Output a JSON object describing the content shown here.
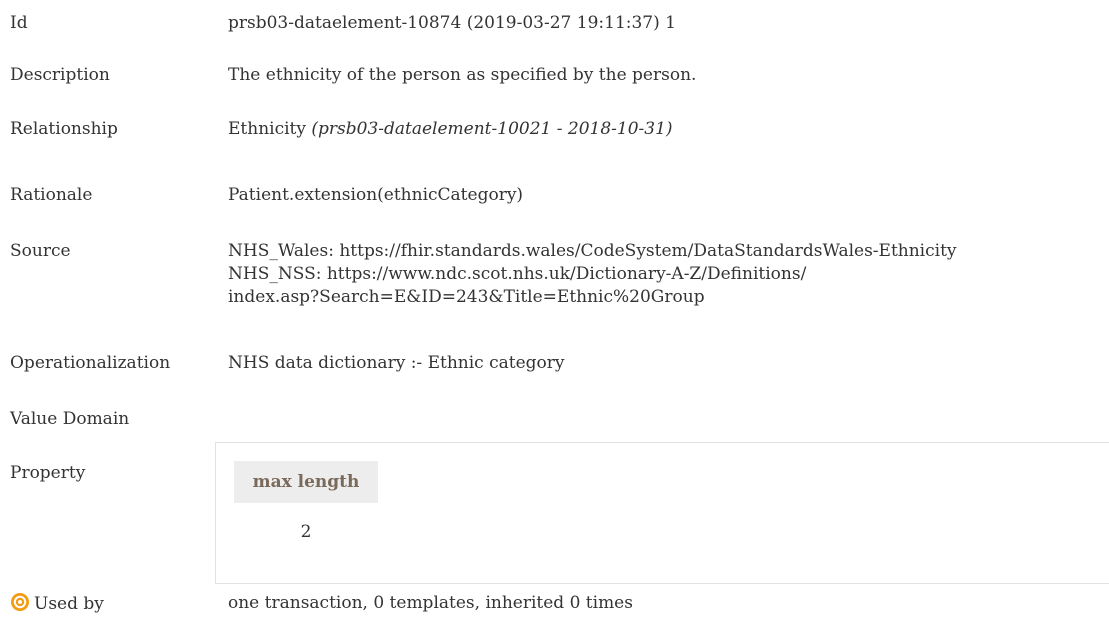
{
  "rows": {
    "id": {
      "label": "Id",
      "value": "prsb03-dataelement-10874 (2019-03-27 19:11:37) 1"
    },
    "description": {
      "label": "Description",
      "value": "The ethnicity of the person as specified by the person."
    },
    "relationship": {
      "label": "Relationship",
      "name": "Ethnicity",
      "ref": "(prsb03-dataelement-10021 - 2018-10-31)"
    },
    "rationale": {
      "label": "Rationale",
      "value": "Patient.extension(ethnicCategory)"
    },
    "source": {
      "label": "Source",
      "lines": [
        "NHS_Wales: https://fhir.standards.wales/CodeSystem/DataStandardsWales-Ethnicity",
        "NHS_NSS: https://www.ndc.scot.nhs.uk/Dictionary-A-Z/Definitions/",
        "index.asp?Search=E&ID=243&Title=Ethnic%20Group"
      ]
    },
    "operationalization": {
      "label": "Operationalization",
      "value": "NHS data dictionary :- Ethnic category"
    },
    "value_domain": {
      "label": "Value Domain"
    },
    "property": {
      "label": "Property",
      "header": "max length",
      "value": "2"
    },
    "used_by": {
      "label": "Used by",
      "icon": "target-icon",
      "icon_color": "#f39c12",
      "value": "one transaction, 0 templates, inherited 0 times"
    }
  }
}
